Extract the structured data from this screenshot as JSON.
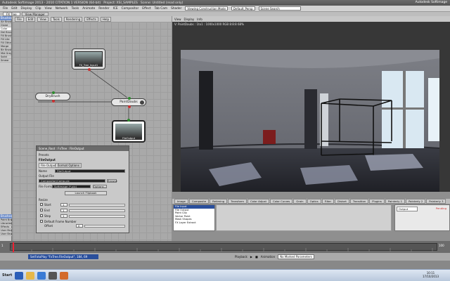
{
  "title_bar": {
    "app": "Autodesk Softimage 2013 - 2010 CITATION 1 VERSION (64-bit)",
    "project": "Project: XSI_SAMPLES",
    "scene": "Scene: Untitled (read only)",
    "brand": "Autodesk Softimage"
  },
  "menubar": {
    "items": [
      "File",
      "Edit",
      "Display",
      "Clip",
      "View",
      "Network",
      "Tools",
      "Animate",
      "Render",
      "ICE",
      "Compositor",
      "Effect",
      "Tab Cam",
      "Shader"
    ],
    "mode": "Viewing Construction Mode",
    "layout": "Default_Persp",
    "search": "Scene Search"
  },
  "top_tabs": [
    "FX Tree",
    "View Manager"
  ],
  "sidebar": {
    "header": "Brushes",
    "items": [
      "Air Brush",
      "Clone",
      "Color",
      "Del Brush",
      "Fill Brush",
      "Fill Lite",
      "Fill Other",
      "Merge",
      "Blr Brush",
      "Mid Grey",
      "Solid",
      "Smear"
    ],
    "selected": 2,
    "lower_header": "Brushes",
    "lower_items": [
      "Paint Brush",
      "Libraries",
      "Effects",
      "User Brushes 1",
      "User Brushes 2"
    ]
  },
  "schematic": {
    "toolbar": [
      "File",
      "Edit",
      "View",
      "Tools",
      "Rendering",
      "Effects",
      "Help"
    ],
    "nodes": {
      "file_input": "FX_Tree_Input1",
      "dry_brush": "DryBrush",
      "paint_daubs": "PaintDaubs",
      "file_output": "FileOutput"
    }
  },
  "property_editor": {
    "title": "Scene_Root : FxTree : FileOutput",
    "preset_label": "Presets",
    "section": "FileOutput",
    "tabs": [
      "File Output",
      "Format Options"
    ],
    "name_label": "Name",
    "name_value": "FileOutput",
    "output_label": "Output File",
    "output_value": "Compositor\\Comp.pic",
    "file_format_label": "File Format",
    "file_format_value": "Softimage (*.pic)",
    "options_button": "Options...",
    "browse_button": "Browse",
    "launch_button": "Launch Flipbook",
    "resize_label": "Resize",
    "start_label": "Start",
    "start_value": "1",
    "end_label": "End",
    "end_value": "1",
    "step_label": "Step",
    "step_value": "1",
    "padding_label": "Default Frame Number",
    "offset_label": "Offset",
    "offset_value": "0"
  },
  "viewer": {
    "toolbar": [
      "View",
      "Display",
      "Info"
    ],
    "info": "V: PaintDaubs : 1to1 : 1000x1000 RGB 8:8:8  68%"
  },
  "tool_tabs": [
    "Image",
    "Composite",
    "Retiming",
    "Transform",
    "Color Adjust",
    "Color Curves",
    "Grain",
    "Optics",
    "Filter",
    "Distort",
    "Transition",
    "Plugins",
    "Painterly 1",
    "Painterly 2",
    "Painterly 3"
  ],
  "tool_list": [
    "File Input",
    "File Output",
    "Paint Clip",
    "Vector Paint",
    "Mask Shapes",
    "FX Layer Extract"
  ],
  "tool_list_selected": 0,
  "right_list": {
    "items": [
      "Output"
    ],
    "badge": "Pending"
  },
  "timeline": {
    "command": "SetFxtoPlay \"FxTree.FileOutput\", 184, 69",
    "current_frame": "1",
    "end_frame": "100",
    "playback_label": "Playback",
    "animation_label": "Animation",
    "no_marked_params": "No Marked Parameters"
  },
  "taskbar": {
    "start": "Start",
    "time": "10:11",
    "date": "17/10/2013"
  },
  "colors": {
    "title_bg": "#5f5f5f",
    "selection_blue": "#2a4f9c",
    "port_green": "#2e8b2e",
    "port_red": "#c33333",
    "playhead": "#e02233"
  }
}
